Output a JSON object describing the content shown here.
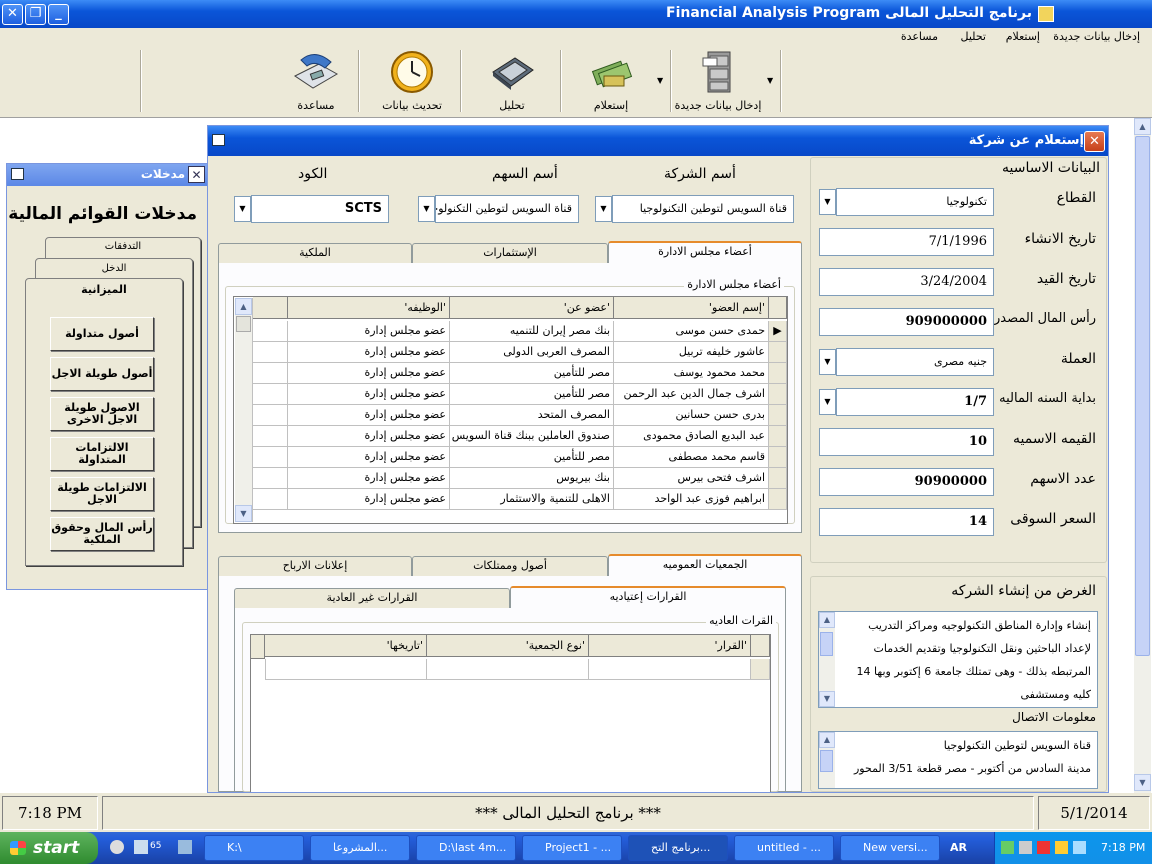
{
  "window": {
    "title": "Financial Analysis Program  برنامج التحليل المالى",
    "buttons": {
      "minimize": "_",
      "maximize": "❐",
      "close": "✕"
    }
  },
  "menu": [
    "إدخال بيانات جديدة",
    "إستعلام",
    "تحليل",
    "مساعدة"
  ],
  "toolbar": [
    {
      "label": "إدخال بيانات جديدة",
      "icon": "cabinet-icon"
    },
    {
      "label": "إستعلام",
      "icon": "money-icon"
    },
    {
      "label": "تحليل",
      "icon": "calculator-icon"
    },
    {
      "label": "تحديث بيانات",
      "icon": "clock-icon"
    },
    {
      "label": "مساعدة",
      "icon": "phone-icon"
    }
  ],
  "inputs_form": {
    "title": "مدخلات",
    "heading": "مدخلات القوائم المالية",
    "tabs": [
      "التدفقات",
      "الدخل",
      "الميزانية"
    ],
    "buttons": [
      "أصول متداولة",
      "أصول طويلة الاجل",
      "الاصول طويلة الاجل الاخرى",
      "الالتزامات المتداولة",
      "الالتزامات طويلة الاجل",
      "رأس المال وحقوق الملكية"
    ]
  },
  "company_form": {
    "title": "إستعلام عن شركة",
    "top_labels": {
      "company_name": "أسم الشركة",
      "stock_name": "أسم السهم",
      "code": "الكود"
    },
    "top_values": {
      "company_name": "قناة السويس لتوطين التكنولوجيا",
      "stock_name": "قناة السويس لتوطين التكنولوجيا",
      "code": "SCTS"
    },
    "basic_info_title": "البيانات الاساسيه",
    "fields": [
      {
        "label": "القطاع",
        "value": "تكنولوجيا"
      },
      {
        "label": "تاريخ الانشاء",
        "value": "7/1/1996"
      },
      {
        "label": "تاريخ القيد",
        "value": "3/24/2004"
      },
      {
        "label": "رأس المال المصدر",
        "value": "909000000"
      },
      {
        "label": "العملة",
        "value": "جنيه مصرى"
      },
      {
        "label": "بداية السنه الماليه",
        "value": "1/7"
      },
      {
        "label": "القيمه الاسميه",
        "value": "10"
      },
      {
        "label": "عدد الاسهم",
        "value": "90900000"
      },
      {
        "label": "السعر السوقى",
        "value": "14"
      }
    ],
    "purpose_title": "الغرض من إنشاء الشركه",
    "purpose_text": "إنشاء وإدارة المناطق التكنولوجيه ومراكز التدريب لإعداد الباحثين ونقل التكنولوجيا وتقديم الخدمات المرتبطه بذلك - وهى تمتلك جامعة 6 إكتوبر وبها 14 كليه ومستشفى",
    "contact_title": "معلومات الاتصال",
    "contact_lines": [
      "قناة السويس لتوطين التكنولوجيا",
      "مدينة السادس من أكتوبر - مصر قطعة 3/51 المحور"
    ],
    "upper_tabs": [
      "أعضاء مجلس الادارة",
      "الإستثمارات",
      "الملكية"
    ],
    "board_frame_title": "أعضاء مجلس الادارة",
    "board_columns": [
      "'إسم العضو'",
      "'عضو عن'",
      "'الوظيفه'"
    ],
    "board_rows": [
      [
        "حمدى حسن موسى",
        "بنك مصر إيران للتنميه",
        "عضو مجلس إدارة"
      ],
      [
        "عاشور خليفه تربيل",
        "المصرف العربى الدولى",
        "عضو مجلس إدارة"
      ],
      [
        "محمد محمود يوسف",
        "مصر للتأمين",
        "عضو مجلس إدارة"
      ],
      [
        "اشرف جمال الدين عبد الرحمن",
        "مصر للتأمين",
        "عضو مجلس إدارة"
      ],
      [
        "بدرى حسن حسانين",
        "المصرف المتحد",
        "عضو مجلس إدارة"
      ],
      [
        "عبد البديع الصادق محمودى",
        "صندوق العاملين ببنك قناة السويس",
        "عضو مجلس إدارة"
      ],
      [
        "قاسم محمد مصطفى",
        "مصر للتأمين",
        "عضو مجلس إدارة"
      ],
      [
        "اشرف فتحى بيرس",
        "بنك بيريوس",
        "عضو مجلس إدارة"
      ],
      [
        "ابراهيم فوزى عبد الواحد",
        "الاهلى للتنمية والاستثمار",
        "عضو مجلس إدارة"
      ]
    ],
    "lower_tabs": [
      "الجمعيات العموميه",
      "أصول وممتلكات",
      "إعلانات الارباح"
    ],
    "inner_tabs": [
      "القرارات إعتياديه",
      "القرارات غير العادية"
    ],
    "resolutions_frame_title": "القرات العاديه",
    "resolutions_columns": [
      "'القرار'",
      "'نوع الجمعية'",
      "'تاريخها'"
    ]
  },
  "status": {
    "time": "7:18 PM",
    "center": "***   برنامج التحليل المالى   ***",
    "date": "5/1/2014"
  },
  "taskbar": {
    "start": "start",
    "quicklaunch_badge": "65",
    "tasks": [
      "K:\\",
      "المشروعا...",
      "D:\\last 4m...",
      "Project1 - ...",
      "برنامج التح...",
      "untitled - ...",
      "New versi..."
    ],
    "lang": "AR",
    "clock": "7:18 PM"
  }
}
